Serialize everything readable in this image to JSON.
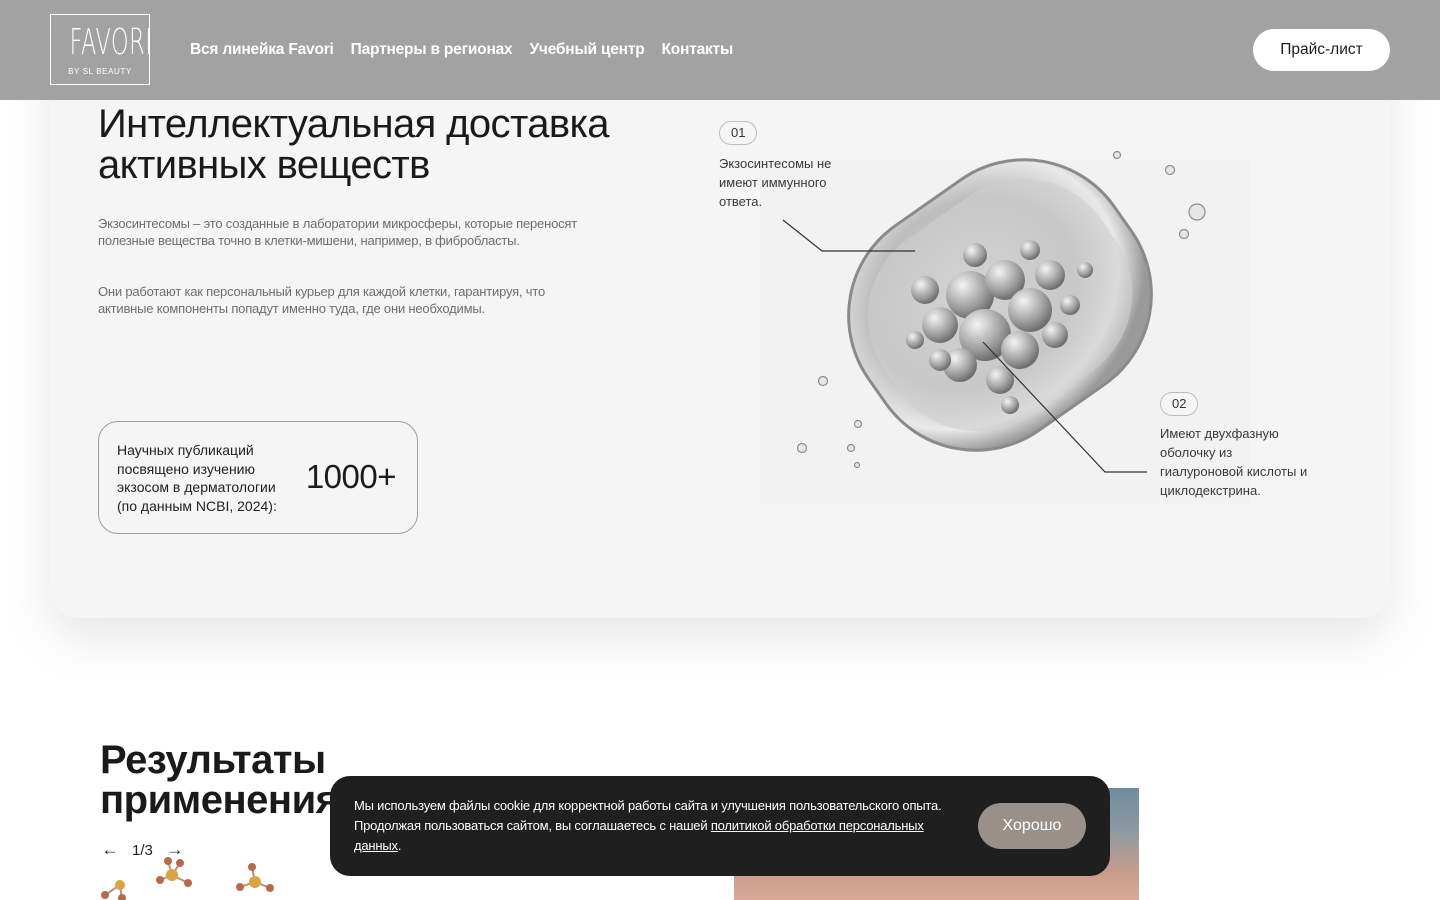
{
  "header": {
    "logo_word": "FAVORI",
    "logo_sub": "BY SL BEAUTY",
    "nav": [
      {
        "label": "Вся линейка Favori"
      },
      {
        "label": "Партнеры в регионах"
      },
      {
        "label": "Учебный центр"
      },
      {
        "label": "Контакты"
      }
    ],
    "price_button": "Прайс-лист"
  },
  "delivery": {
    "title": "Интеллектуальная доставка активных веществ",
    "paragraph_1": "Экзосинтесомы – это созданные в лаборатории микросферы, которые переносят полезные вещества точно в клетки-мишени, например, в фибробласты.",
    "paragraph_2": "Они работают как персональный курьер для каждой клетки, гарантируя, что активные компоненты попадут именно туда, где они необходимы.",
    "stat": {
      "label": "Научных публикаций посвящено изучению экзосом в дерматологии (по данным NCBI, 2024):",
      "value": "1000+"
    },
    "callouts": [
      {
        "number": "01",
        "text": "Экзосинтесомы не имеют иммунного ответа."
      },
      {
        "number": "02",
        "text": "Имеют двухфазную оболочку из гиалуроновой кислоты и циклодекстрина."
      }
    ]
  },
  "results": {
    "title": "Результаты применения",
    "pager": {
      "prev": "←",
      "count": "1/3",
      "next": "→"
    }
  },
  "cookie": {
    "text": "Мы используем файлы cookie для корректной работы сайта и улучшения пользовательского опыта. Продолжая пользоваться сайтом, вы соглашаетесь с нашей ",
    "link": "политикой обработки персональных данных",
    "suffix": ".",
    "button": "Хорошо"
  },
  "colors": {
    "header_bg": "#969697",
    "card_bg": "#f5f5f5",
    "cookie_bg": "#1f1f1f",
    "ok_button": "#999189"
  }
}
